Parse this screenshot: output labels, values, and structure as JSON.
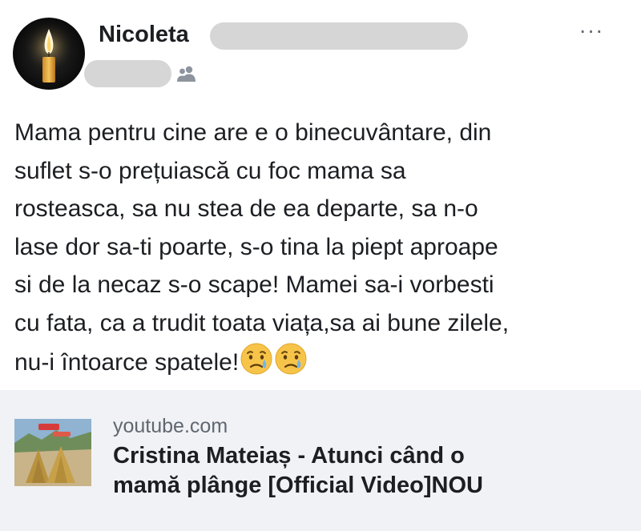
{
  "post": {
    "author": "Nicoleta",
    "text_lines": [
      "Mama pentru cine are e o binecuvântare,  din",
      "suflet s-o  prețuiască cu foc mama sa",
      "rosteasca, sa nu stea de ea departe,  sa n-o",
      "lase dor sa-ti poarte, s-o tina la piept aproape",
      "si de la necaz s-o scape! Mamei sa-i vorbesti",
      "cu fata, ca a trudit toata viața,sa ai bune zilele,",
      "nu-i întoarce spatele!"
    ],
    "emojis": [
      "crying-face",
      "crying-face"
    ],
    "more_label": "···",
    "audience_icon": "friends-icon"
  },
  "link": {
    "domain": "youtube.com",
    "title_lines": [
      "Cristina Mateiaș - Atunci când o",
      "mamă plânge [Official Video]NOU"
    ]
  },
  "colors": {
    "redaction": "#d6d6d6",
    "card_background": "#f0f2f5",
    "secondary_text": "#606770"
  }
}
